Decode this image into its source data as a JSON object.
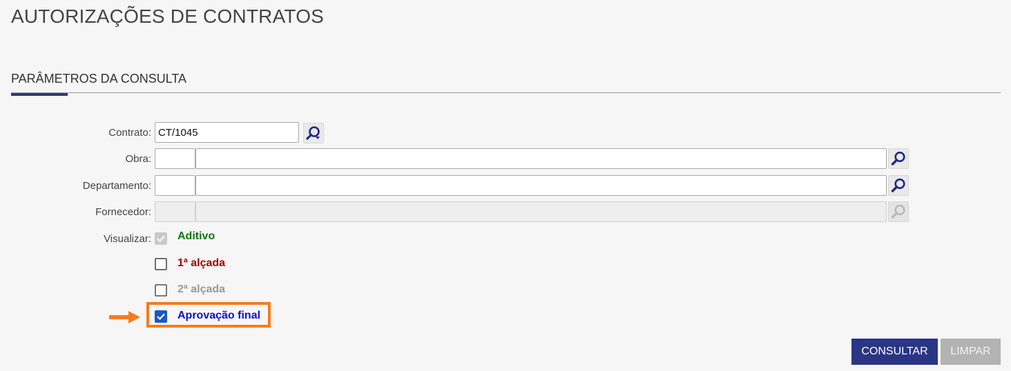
{
  "page": {
    "title": "AUTORIZAÇÕES DE CONTRATOS"
  },
  "section": {
    "title": "PARÂMETROS DA CONSULTA"
  },
  "form": {
    "contrato": {
      "label": "Contrato:",
      "value": "CT/1045",
      "icon": "search-refresh-icon"
    },
    "obra": {
      "label": "Obra:",
      "code": "",
      "name": "",
      "icon": "search-icon"
    },
    "departamento": {
      "label": "Departamento:",
      "code": "",
      "name": "",
      "icon": "search-icon"
    },
    "fornecedor": {
      "label": "Fornecedor:",
      "code": "",
      "name": "",
      "disabled": true,
      "icon": "search-icon"
    },
    "visualizar": {
      "label": "Visualizar:",
      "options": [
        {
          "label": "Aditivo",
          "checked": true,
          "disabled": true,
          "color": "#0a7a0a"
        },
        {
          "label": "1ª alçada",
          "checked": false,
          "disabled": false,
          "color": "#a00000"
        },
        {
          "label": "2ª alçada",
          "checked": false,
          "disabled": false,
          "color": "#999999"
        },
        {
          "label": "Aprovação final",
          "checked": true,
          "disabled": false,
          "color": "#1010d8"
        }
      ]
    }
  },
  "buttons": {
    "consultar": "CONSULTAR",
    "limpar": "LIMPAR"
  },
  "colors": {
    "accent": "#2b3a87",
    "highlight": "#f47b20",
    "primary_button": "#2b3585"
  }
}
